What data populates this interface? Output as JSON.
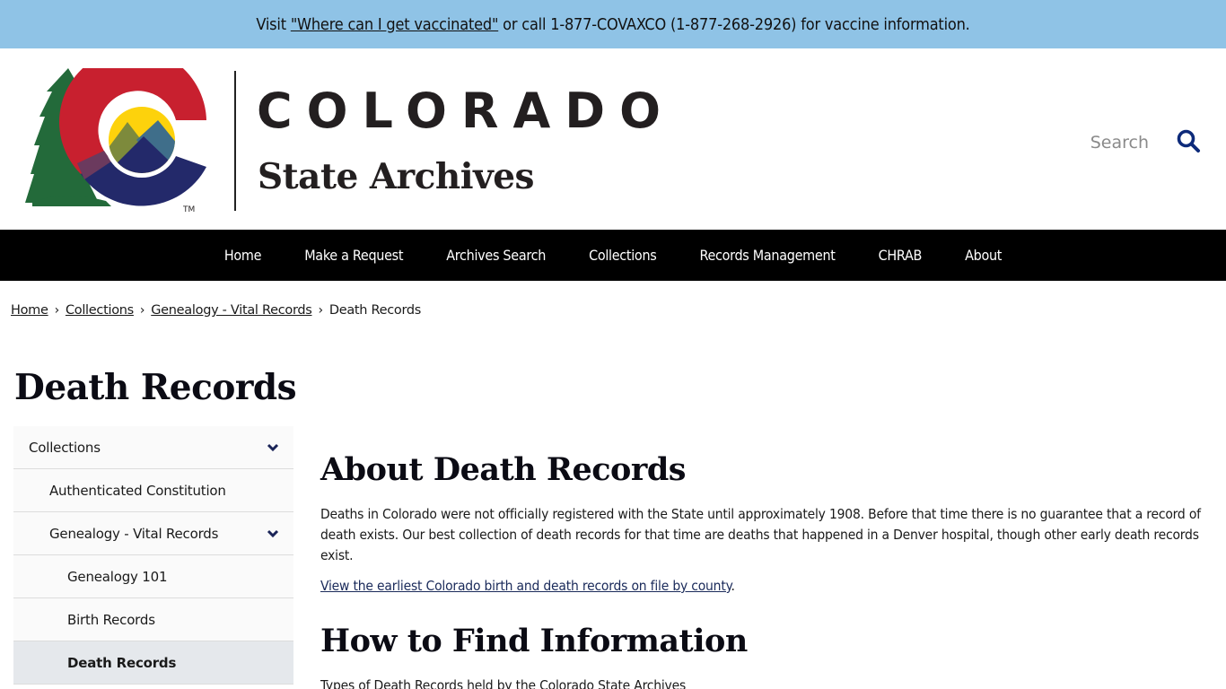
{
  "alert": {
    "prefix": "Visit ",
    "link_text": "\"Where can I get vaccinated\"",
    "suffix": " or call 1-877-COVAXCO (1-877-268-2926) for vaccine information."
  },
  "header": {
    "logo_line1": "COLORADO",
    "logo_line2": "State Archives",
    "logo_tm": "TM",
    "search_placeholder": "Search",
    "search_icon": "search-icon"
  },
  "nav": {
    "items": [
      {
        "label": "Home"
      },
      {
        "label": "Make a Request"
      },
      {
        "label": "Archives Search"
      },
      {
        "label": "Collections"
      },
      {
        "label": "Records Management"
      },
      {
        "label": "CHRAB"
      },
      {
        "label": "About"
      }
    ]
  },
  "breadcrumb": {
    "items": [
      {
        "label": "Home",
        "link": true
      },
      {
        "label": "Collections",
        "link": true
      },
      {
        "label": "Genealogy - Vital Records",
        "link": true
      },
      {
        "label": "Death Records",
        "link": false
      }
    ],
    "separator": "›"
  },
  "page": {
    "title": "Death Records"
  },
  "sidenav": {
    "items": [
      {
        "label": "Collections",
        "level": 1,
        "expandable": true,
        "active": false
      },
      {
        "label": "Authenticated Constitution",
        "level": 2,
        "expandable": false,
        "active": false
      },
      {
        "label": "Genealogy - Vital Records",
        "level": 2,
        "expandable": true,
        "active": false
      },
      {
        "label": "Genealogy 101",
        "level": 3,
        "expandable": false,
        "active": false
      },
      {
        "label": "Birth Records",
        "level": 3,
        "expandable": false,
        "active": false
      },
      {
        "label": "Death Records",
        "level": 3,
        "expandable": false,
        "active": true
      }
    ]
  },
  "content": {
    "section1": {
      "heading": "About Death Records",
      "paragraph": "Deaths in Colorado were not officially registered with the State until approximately 1908. Before that time there is no guarantee that a record of death exists. Our best collection of death records for that time are deaths that happened in a Denver hospital, though other early death records exist.",
      "link_text": "View the earliest Colorado birth and death records on file by county",
      "link_suffix": "."
    },
    "section2": {
      "heading": "How to Find Information",
      "paragraph": "Types of Death Records held by the Colorado State Archives"
    }
  },
  "colors": {
    "alert_bg": "#8fc3e6",
    "nav_bg": "#000000",
    "search_icon": "#0d2a7a",
    "active_sidenav_bg": "#e5e8ec",
    "logo_red": "#c8202f",
    "logo_blue": "#23296a",
    "logo_green": "#236a3a",
    "logo_yellow": "#fdd20c"
  }
}
